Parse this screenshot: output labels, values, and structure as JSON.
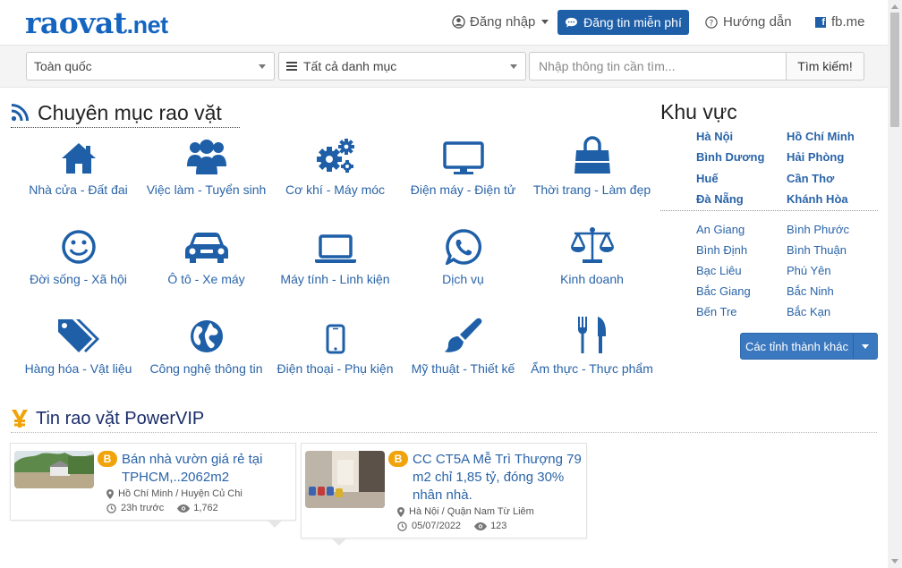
{
  "brand": {
    "logo_main": "raovat",
    "logo_tld": ".net"
  },
  "header": {
    "login": "Đăng nhập",
    "post_button": "Đăng tin miễn phí",
    "help": "Hướng dẫn",
    "fb": "fb.me"
  },
  "search": {
    "region": "Toàn quốc",
    "category": "Tất cả danh mục",
    "placeholder": "Nhập thông tin cần tìm...",
    "button": "Tìm kiếm!"
  },
  "categories_title": "Chuyên mục rao vặt",
  "categories": [
    {
      "label": "Nhà cửa - Đất đai",
      "icon": "house-icon"
    },
    {
      "label": "Việc làm - Tuyển sinh",
      "icon": "people-icon"
    },
    {
      "label": "Cơ khí - Máy móc",
      "icon": "gears-icon"
    },
    {
      "label": "Điện máy - Điện tử",
      "icon": "monitor-icon"
    },
    {
      "label": "Thời trang - Làm đẹp",
      "icon": "shopping-bag-icon"
    },
    {
      "label": "Đời sống - Xã hội",
      "icon": "smiley-icon"
    },
    {
      "label": "Ô tô - Xe máy",
      "icon": "car-icon"
    },
    {
      "label": "Máy tính - Linh kiện",
      "icon": "laptop-icon"
    },
    {
      "label": "Dịch vụ",
      "icon": "whatsapp-icon"
    },
    {
      "label": "Kinh doanh",
      "icon": "scales-icon"
    },
    {
      "label": "Hàng hóa - Vật liệu",
      "icon": "tags-icon"
    },
    {
      "label": "Công nghệ thông tin",
      "icon": "globe-icon"
    },
    {
      "label": "Điện thoại - Phụ kiện",
      "icon": "mobile-phone-icon"
    },
    {
      "label": "Mỹ thuật - Thiết kế",
      "icon": "paintbrush-icon"
    },
    {
      "label": "Ẩm thực - Thực phẩm",
      "icon": "cutlery-icon"
    }
  ],
  "region": {
    "title": "Khu vực",
    "major": [
      "Hà Nội",
      "Hồ Chí Minh",
      "Bình Dương",
      "Hải Phòng",
      "Huế",
      "Cần Thơ",
      "Đà Nẵng",
      "Khánh Hòa"
    ],
    "provinces": [
      "An Giang",
      "Bình Phước",
      "Bình Định",
      "Bình Thuận",
      "Bạc Liêu",
      "Phú Yên",
      "Bắc Giang",
      "Bắc Ninh",
      "Bến Tre",
      "Bắc Kạn"
    ],
    "more_button": "Các tỉnh thành khác"
  },
  "vip": {
    "title": "Tin rao vặt PowerVIP",
    "listings": [
      {
        "badge": "B",
        "title": "Bán nhà vườn giá rẻ tại TPHCM,..2062m2",
        "location": "Hồ Chí Minh / Huyện Củ Chi",
        "time": "23h trước",
        "views": "1,762"
      },
      {
        "badge": "B",
        "title": "CC CT5A Mễ Trì Thượng 79 m2 chỉ 1,85 tỷ, đóng 30% nhân nhà.",
        "location": "Hà Nội / Quận Nam Từ Liêm",
        "time": "05/07/2022",
        "views": "123"
      }
    ]
  },
  "colors": {
    "brand": "#1e5fa8",
    "badge": "#f0a30a",
    "link": "#2a64a8"
  }
}
